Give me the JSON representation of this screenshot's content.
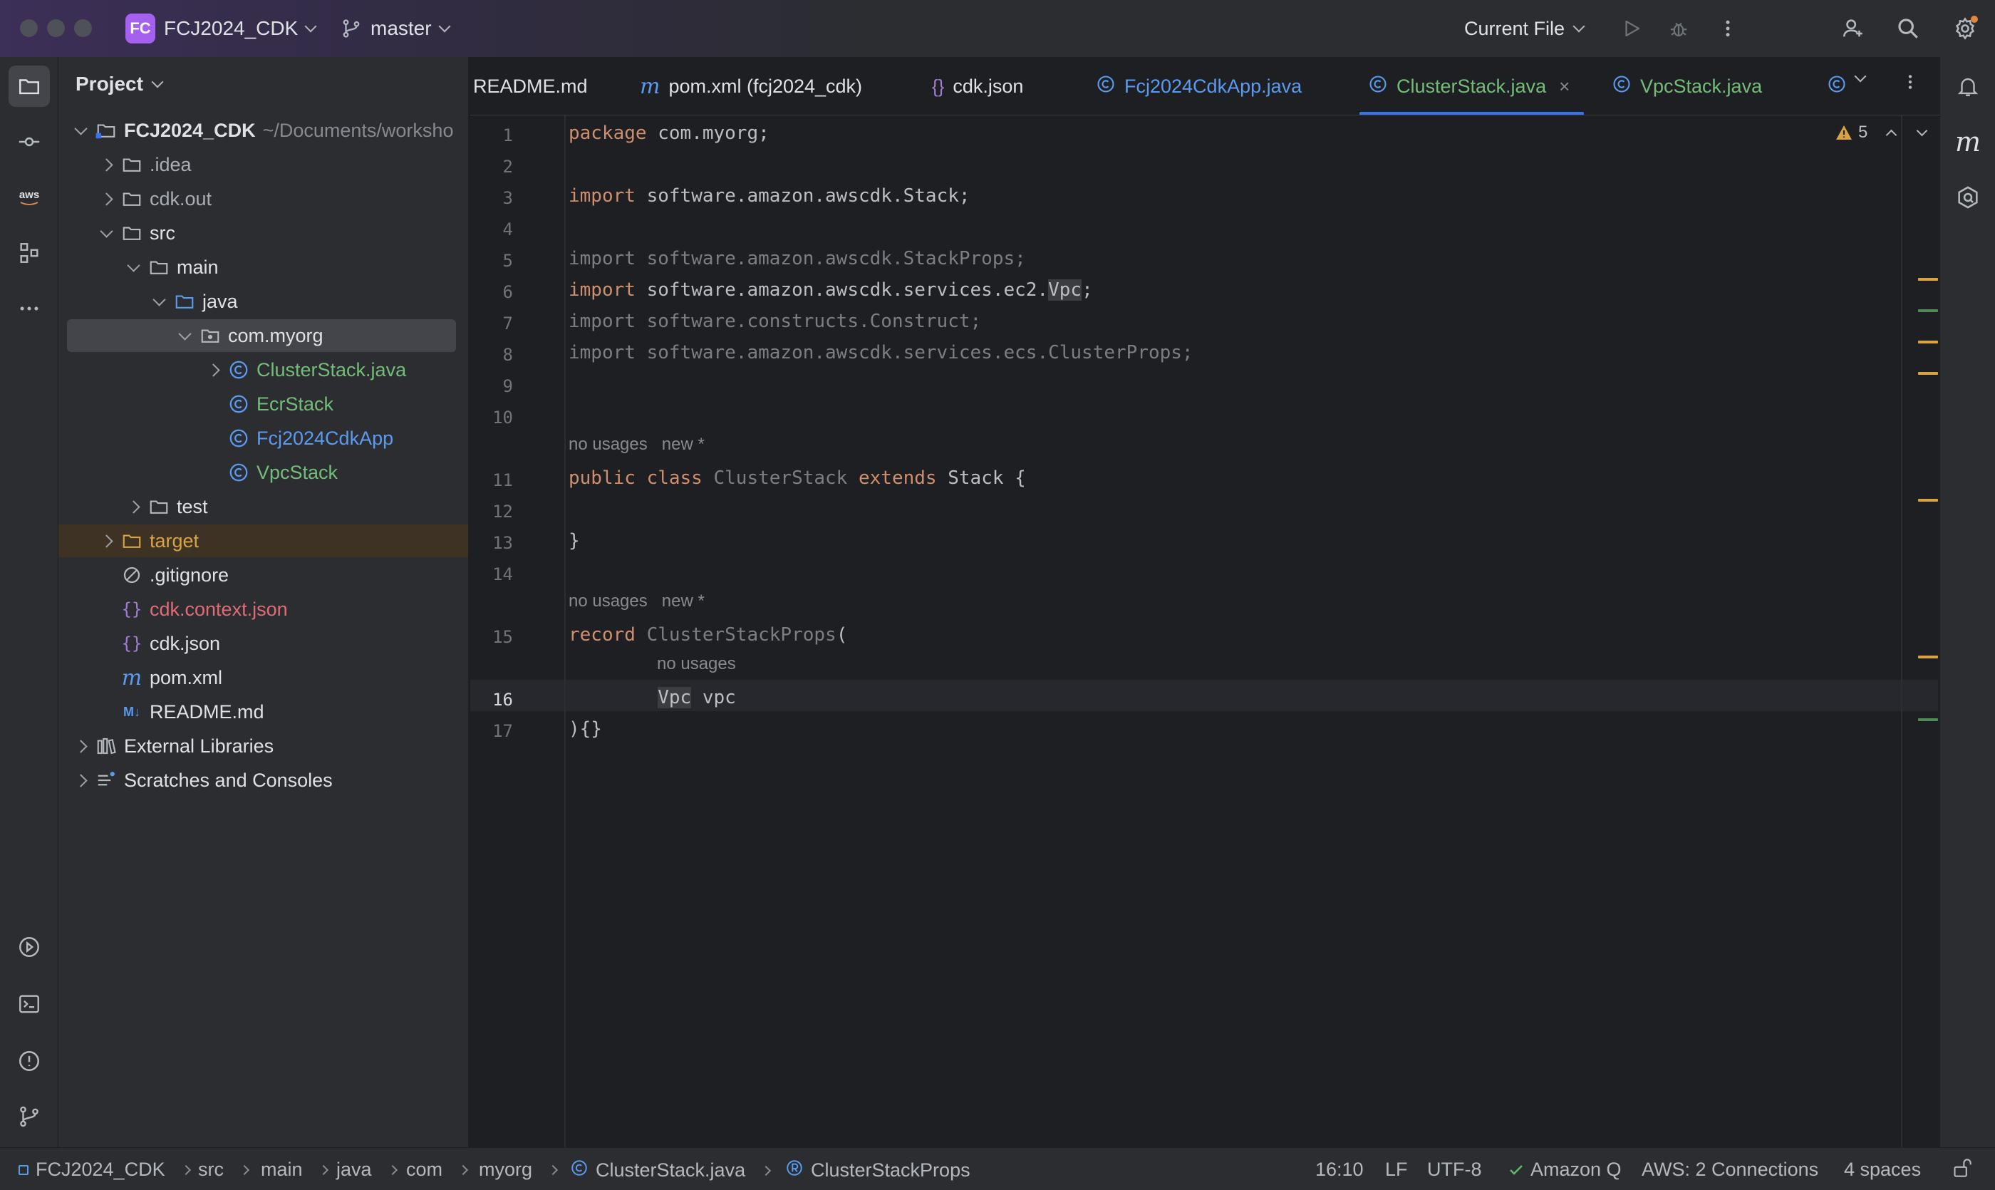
{
  "titlebar": {
    "project_badge": "FC",
    "project_name": "FCJ2024_CDK",
    "branch": "master",
    "run_config": "Current File"
  },
  "project_panel": {
    "title": "Project",
    "tree": [
      {
        "label": "FCJ2024_CDK",
        "path": "~/Documents/worksho",
        "depth": 0,
        "arrow": "down",
        "icon": "module-folder-icon",
        "style": "bold"
      },
      {
        "label": ".idea",
        "depth": 1,
        "arrow": "right",
        "icon": "folder-icon",
        "style": "gray"
      },
      {
        "label": "cdk.out",
        "depth": 1,
        "arrow": "right",
        "icon": "folder-icon",
        "style": "gray"
      },
      {
        "label": "src",
        "depth": 1,
        "arrow": "down",
        "icon": "folder-icon",
        "style": "normal"
      },
      {
        "label": "main",
        "depth": 2,
        "arrow": "down",
        "icon": "folder-icon",
        "style": "normal"
      },
      {
        "label": "java",
        "depth": 3,
        "arrow": "down",
        "icon": "source-folder-icon",
        "style": "normal"
      },
      {
        "label": "com.myorg",
        "depth": 4,
        "arrow": "down",
        "icon": "package-icon",
        "style": "normal",
        "selected": true
      },
      {
        "label": "ClusterStack.java",
        "depth": 5,
        "arrow": "right",
        "icon": "java-class-icon",
        "style": "green"
      },
      {
        "label": "EcrStack",
        "depth": 5,
        "arrow": "none",
        "icon": "java-class-icon",
        "style": "green"
      },
      {
        "label": "Fcj2024CdkApp",
        "depth": 5,
        "arrow": "none",
        "icon": "java-class-icon",
        "style": "blue"
      },
      {
        "label": "VpcStack",
        "depth": 5,
        "arrow": "none",
        "icon": "java-class-icon",
        "style": "green"
      },
      {
        "label": "test",
        "depth": 2,
        "arrow": "right",
        "icon": "folder-icon",
        "style": "normal"
      },
      {
        "label": "target",
        "depth": 1,
        "arrow": "right",
        "icon": "excluded-folder-icon",
        "style": "orange",
        "excluded": true
      },
      {
        "label": ".gitignore",
        "depth": 1,
        "arrow": "none",
        "icon": "ignore-file-icon",
        "style": "normal"
      },
      {
        "label": "cdk.context.json",
        "depth": 1,
        "arrow": "none",
        "icon": "json-icon",
        "style": "red"
      },
      {
        "label": "cdk.json",
        "depth": 1,
        "arrow": "none",
        "icon": "json-icon",
        "style": "normal"
      },
      {
        "label": "pom.xml",
        "depth": 1,
        "arrow": "none",
        "icon": "maven-icon",
        "style": "normal"
      },
      {
        "label": "README.md",
        "depth": 1,
        "arrow": "none",
        "icon": "markdown-icon",
        "style": "normal"
      },
      {
        "label": "External Libraries",
        "depth": 0,
        "arrow": "right",
        "icon": "library-icon",
        "style": "normal"
      },
      {
        "label": "Scratches and Consoles",
        "depth": 0,
        "arrow": "right",
        "icon": "scratches-icon",
        "style": "normal"
      }
    ]
  },
  "tabs": [
    {
      "label": "README.md",
      "icon": "none",
      "color": "#dfe1e5"
    },
    {
      "label": "pom.xml (fcj2024_cdk)",
      "icon": "maven-icon",
      "color": "#dfe1e5"
    },
    {
      "label": "cdk.json",
      "icon": "json-icon",
      "color": "#dfe1e5"
    },
    {
      "label": "Fcj2024CdkApp.java",
      "icon": "java-class-icon",
      "color": "#5a9bf0"
    },
    {
      "label": "ClusterStack.java",
      "icon": "java-class-icon",
      "color": "#73bd79",
      "active": true
    },
    {
      "label": "VpcStack.java",
      "icon": "java-class-icon",
      "color": "#73bd79"
    }
  ],
  "editor": {
    "inspection_count": "5",
    "lines": [
      {
        "n": "1",
        "code": [
          {
            "t": "package ",
            "c": "kw"
          },
          {
            "t": "com.myorg;",
            "c": ""
          }
        ]
      },
      {
        "n": "2",
        "code": []
      },
      {
        "n": "3",
        "code": [
          {
            "t": "import ",
            "c": "kw"
          },
          {
            "t": "software.amazon.awscdk.Stack;",
            "c": ""
          }
        ]
      },
      {
        "n": "4",
        "code": []
      },
      {
        "n": "5",
        "code": [
          {
            "t": "import software.amazon.awscdk.StackProps;",
            "c": "dimc"
          }
        ]
      },
      {
        "n": "6",
        "code": [
          {
            "t": "import ",
            "c": "kw"
          },
          {
            "t": "software.amazon.awscdk.services.ec2.",
            "c": ""
          },
          {
            "t": "Vpc",
            "c": "hl"
          },
          {
            "t": ";",
            "c": ""
          }
        ]
      },
      {
        "n": "7",
        "code": [
          {
            "t": "import software.constructs.Construct;",
            "c": "dimc"
          }
        ]
      },
      {
        "n": "8",
        "code": [
          {
            "t": "import software.amazon.awscdk.services.ecs.ClusterProps;",
            "c": "dimc"
          }
        ]
      },
      {
        "n": "9",
        "code": []
      },
      {
        "n": "10",
        "code": []
      },
      {
        "n": "11",
        "code": [
          {
            "t": "public class ",
            "c": "kw"
          },
          {
            "t": "ClusterStack ",
            "c": "dimc"
          },
          {
            "t": "extends ",
            "c": "kw"
          },
          {
            "t": "Stack {",
            "c": ""
          }
        ]
      },
      {
        "n": "12",
        "code": []
      },
      {
        "n": "13",
        "code": [
          {
            "t": "}",
            "c": ""
          }
        ]
      },
      {
        "n": "14",
        "code": []
      },
      {
        "n": "15",
        "code": [
          {
            "t": "record ",
            "c": "kw"
          },
          {
            "t": "ClusterStackProps",
            "c": "dimc"
          },
          {
            "t": "(",
            "c": ""
          }
        ]
      },
      {
        "n": "16",
        "code": [
          {
            "t": "        ",
            "c": ""
          },
          {
            "t": "Vpc",
            "c": "hl"
          },
          {
            "t": " vpc",
            "c": ""
          }
        ]
      },
      {
        "n": "17",
        "code": [
          {
            "t": "){}",
            "c": ""
          }
        ]
      }
    ],
    "hints": {
      "class_hint": "no usages   new *",
      "record_hint": "no usages   new *",
      "param_hint": "no usages"
    }
  },
  "statusbar": {
    "breadcrumbs": [
      "FCJ2024_CDK",
      "src",
      "main",
      "java",
      "com",
      "myorg",
      "ClusterStack.java",
      "ClusterStackProps"
    ],
    "position": "16:10",
    "line_separator": "LF",
    "encoding": "UTF-8",
    "amazon_q": "Amazon Q",
    "aws": "AWS: 2 Connections",
    "indent": "4 spaces"
  },
  "colors": {
    "accent": "#3574f0",
    "project_badge": "#a560f0",
    "vcs_added_green": "#73bd79",
    "excluded_orange": "#d9a343",
    "untracked_red": "#e06c75",
    "keyword": "#cf8e6d"
  }
}
